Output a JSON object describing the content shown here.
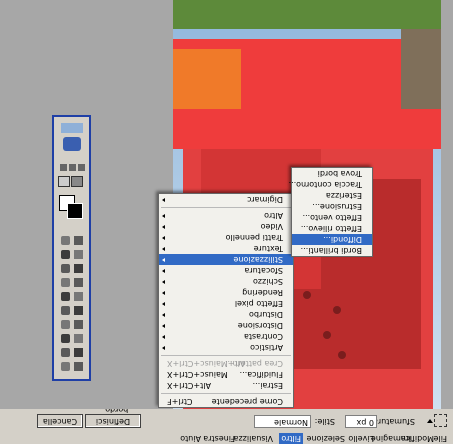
{
  "menubar": {
    "items": [
      "File",
      "Modifica",
      "Immagine",
      "Livello",
      "Selezione",
      "Filtro",
      "Visualizza",
      "Finestra",
      "Aiuto"
    ],
    "open_index": 5
  },
  "options_bar": {
    "sfumatura_label": "Sfumatura:",
    "sfumatura_value": "0 px",
    "stile_label": "Stile:",
    "stile_value": "Normale",
    "buttons": [
      "Definisci bordo...",
      "Cancella"
    ]
  },
  "filter_menu": {
    "items": [
      {
        "label": "Come precedente",
        "shortcut": "Ctrl+F",
        "type": "item",
        "disabled": false
      },
      {
        "type": "sep"
      },
      {
        "label": "Estrai...",
        "shortcut": "Alt+Ctrl+X",
        "type": "item",
        "disabled": false
      },
      {
        "label": "Fluidifica...",
        "shortcut": "Maiusc+Ctrl+X",
        "type": "item",
        "disabled": false
      },
      {
        "label": "Crea pattern...",
        "shortcut": "Alt+Maiusc+Ctrl+X",
        "type": "item",
        "disabled": true
      },
      {
        "type": "sep"
      },
      {
        "label": "Artistico",
        "type": "submenu"
      },
      {
        "label": "Contrasta",
        "type": "submenu"
      },
      {
        "label": "Distorsione",
        "type": "submenu"
      },
      {
        "label": "Disturbo",
        "type": "submenu"
      },
      {
        "label": "Effetto pixel",
        "type": "submenu"
      },
      {
        "label": "Rendering",
        "type": "submenu"
      },
      {
        "label": "Schizzo",
        "type": "submenu"
      },
      {
        "label": "Sfocatura",
        "type": "submenu"
      },
      {
        "label": "Stilizzazione",
        "type": "submenu",
        "selected": true
      },
      {
        "label": "Texture",
        "type": "submenu"
      },
      {
        "label": "Tratti pennello",
        "type": "submenu"
      },
      {
        "label": "Video",
        "type": "submenu"
      },
      {
        "label": "Altro",
        "type": "submenu"
      },
      {
        "type": "sep"
      },
      {
        "label": "Digimarc",
        "type": "submenu"
      }
    ]
  },
  "submenu": {
    "items": [
      {
        "label": "Bordi brillanti..."
      },
      {
        "label": "Diffondi...",
        "selected": true
      },
      {
        "label": "Effetto rilievo..."
      },
      {
        "label": "Effetto vento..."
      },
      {
        "label": "Estrusione..."
      },
      {
        "label": "Esterizza"
      },
      {
        "label": "Traccia contorno..."
      },
      {
        "label": "Trova bordi"
      }
    ]
  },
  "colors": {
    "menu_highlight": "#316ac5",
    "red_overlay": "#ff2b2b",
    "toolbox_border": "#1f3fa6"
  }
}
